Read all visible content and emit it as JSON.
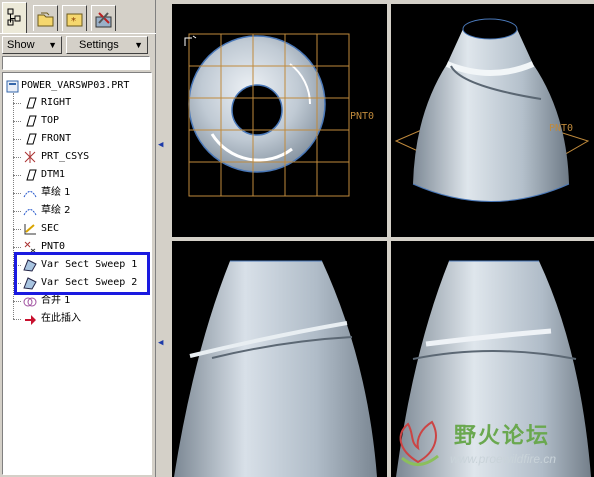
{
  "colors": {
    "viewport_bg": "#000000",
    "grid": "#c08a3c",
    "selection_box": "#1a1ae0",
    "watermark_green": "#6aa84f",
    "surface": "#c9d3db"
  },
  "tabs": [
    {
      "icon": "model-tree-icon",
      "active": true
    },
    {
      "icon": "folder-icon",
      "active": false
    },
    {
      "icon": "favorites-icon",
      "active": false
    },
    {
      "icon": "tools-icon",
      "active": false
    }
  ],
  "toolbar": {
    "show_label": "Show",
    "settings_label": "Settings"
  },
  "tree": {
    "root": "POWER_VARSWP03.PRT",
    "items": [
      {
        "label": "RIGHT",
        "icon": "datum-plane-icon"
      },
      {
        "label": "TOP",
        "icon": "datum-plane-icon"
      },
      {
        "label": "FRONT",
        "icon": "datum-plane-icon"
      },
      {
        "label": "PRT_CSYS",
        "icon": "csys-icon"
      },
      {
        "label": "DTM1",
        "icon": "datum-plane-icon"
      },
      {
        "label": "草绘 1",
        "icon": "sketch-icon"
      },
      {
        "label": "草绘 2",
        "icon": "sketch-icon"
      },
      {
        "label": "SEC",
        "icon": "section-icon"
      },
      {
        "label": "PNT0",
        "icon": "datum-point-icon"
      },
      {
        "label": "Var Sect Sweep 1",
        "icon": "sweep-icon"
      },
      {
        "label": "Var Sect Sweep 2",
        "icon": "sweep-icon"
      },
      {
        "label": "合并 1",
        "icon": "merge-icon"
      },
      {
        "label": "在此插入",
        "icon": "insert-here-icon"
      }
    ]
  },
  "viewports": {
    "top_view_point_label": "PNT0",
    "iso_view_point_label": "PNT0"
  },
  "watermark": {
    "title": "野火论坛",
    "url": "www.proewildfire.cn"
  }
}
